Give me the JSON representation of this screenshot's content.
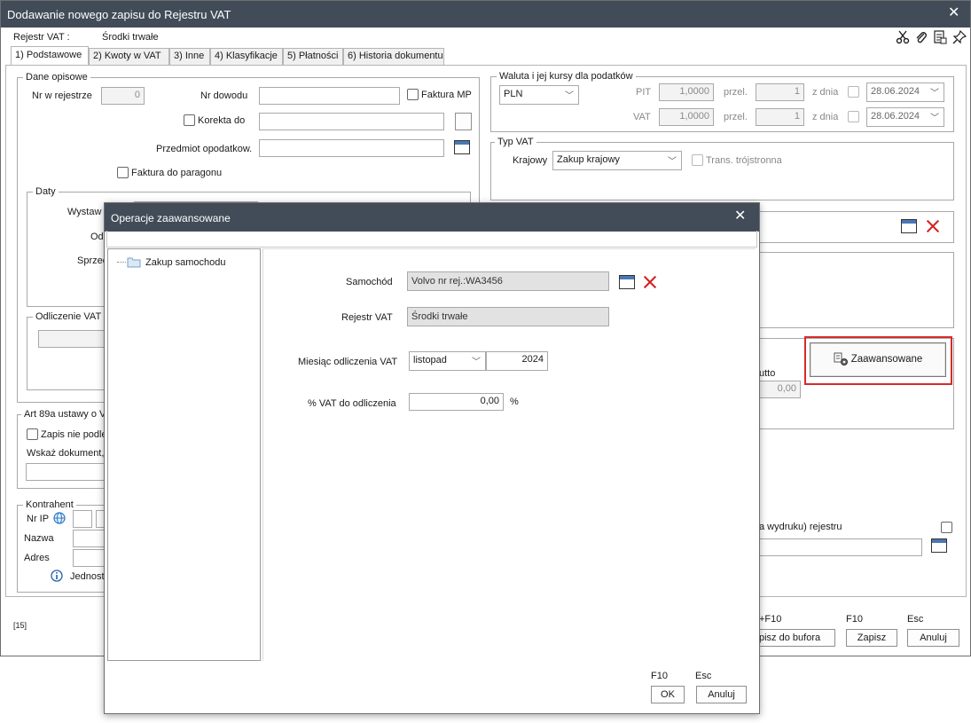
{
  "window": {
    "title": "Dodawanie nowego zapisu do Rejestru VAT",
    "rejestr_label": "Rejestr VAT :",
    "rejestr_value": "Środki trwałe"
  },
  "tabs": [
    {
      "label": "1) Podstawowe"
    },
    {
      "label": "2) Kwoty w VAT"
    },
    {
      "label": "3) Inne"
    },
    {
      "label": "4) Klasyfikacje"
    },
    {
      "label": "5) Płatności"
    },
    {
      "label": "6) Historia dokumentu"
    }
  ],
  "dane": {
    "legend": "Dane opisowe",
    "nr_label": "Nr w rejestrze",
    "nr_value": "0",
    "dowod_label": "Nr dowodu",
    "faktura_mp": "Faktura MP",
    "korekta": "Korekta do",
    "przedmiot": "Przedmiot opodatkow.",
    "paragon": "Faktura do paragonu"
  },
  "daty": {
    "legend": "Daty",
    "wystaw": "Wystaw",
    "odb": "Odb",
    "sprzed": "Sprzed"
  },
  "odliczenie": {
    "legend": "Odliczenie VAT -"
  },
  "art": {
    "legend": "Art 89a ustawy o V",
    "zapis": "Zapis nie podle",
    "wskaz": "Wskaż dokument,"
  },
  "kontrahent": {
    "legend": "Kontrahent",
    "nrip": "Nr IP",
    "nazwa": "Nazwa",
    "adres": "Adres",
    "jednost": "Jednost"
  },
  "waluta": {
    "legend": "Waluta i jej kursy dla podatków",
    "currency": "PLN",
    "pit_label": "PIT",
    "pit_value": "1,0000",
    "vat_label": "VAT",
    "vat_value": "1,0000",
    "przel_label": "przel.",
    "przel_value": "1",
    "zdnia_label": "z dnia",
    "date_value": "28.06.2024"
  },
  "typvat": {
    "legend": "Typ VAT",
    "krajowy_label": "Krajowy",
    "krajowy_value": "Zakup krajowy",
    "trans": "Trans. trójstronna"
  },
  "right": {
    "zaawansowane": "Zaawansowane",
    "brutto_partial": "utto",
    "brutto_value": "0,00",
    "wydruk_partial": "a wydruku) rejestru"
  },
  "footer": {
    "code": "[15]",
    "hint1": "+F10",
    "btn1": "pisz do bufora",
    "hint2": "F10",
    "btn2": "Zapisz",
    "hint3": "Esc",
    "btn3": "Anuluj"
  },
  "dialog": {
    "title": "Operacje zaawansowane",
    "tree_item": "Zakup samochodu",
    "samochod_label": "Samochód",
    "samochod_value": "Volvo nr rej.:WA3456",
    "rejestr_label": "Rejestr VAT",
    "rejestr_value": "Środki trwałe",
    "miesiac_label": "Miesiąc odliczenia VAT",
    "miesiac_value": "listopad",
    "year_value": "2024",
    "proc_label": "% VAT do odliczenia",
    "proc_value": "0,00",
    "proc_unit": "%",
    "ok_hint": "F10",
    "ok": "OK",
    "cancel_hint": "Esc",
    "cancel": "Anuluj"
  },
  "colors": {
    "titlebar": "#424c58",
    "highlight": "#d62b2b"
  }
}
